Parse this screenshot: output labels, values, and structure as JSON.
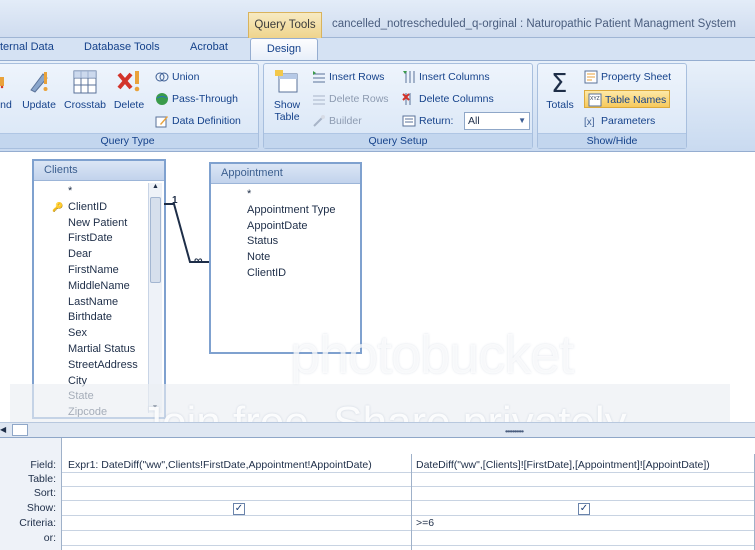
{
  "titlebar": {
    "context_tab": "Query Tools",
    "title": "cancelled_notrescheduled_q-orginal : Naturopathic Patient Managment System"
  },
  "tabs": {
    "external_data": "ternal Data",
    "database_tools": "Database Tools",
    "acrobat": "Acrobat",
    "design": "Design"
  },
  "ribbon": {
    "query_type": {
      "label": "Query Type",
      "buttons": [
        "nd",
        "Update",
        "Crosstab",
        "Delete"
      ],
      "small": [
        "Union",
        "Pass-Through",
        "Data Definition"
      ]
    },
    "query_setup": {
      "label": "Query Setup",
      "show_table": [
        "Show",
        "Table"
      ],
      "col1": [
        "Insert Rows",
        "Delete Rows",
        "Builder"
      ],
      "col2": [
        "Insert Columns",
        "Delete Columns",
        "Return:"
      ],
      "return_value": "All"
    },
    "show_hide": {
      "label": "Show/Hide",
      "totals": "Totals",
      "items": [
        "Property Sheet",
        "Table Names",
        "Parameters"
      ]
    }
  },
  "tables": {
    "clients": {
      "title": "Clients",
      "fields": [
        "*",
        "ClientID",
        "New Patient",
        "FirstDate",
        "Dear",
        "FirstName",
        "MiddleName",
        "LastName",
        "Birthdate",
        "Sex",
        "Martial Status",
        "StreetAddress",
        "City",
        "State",
        "Zipcode"
      ]
    },
    "appointment": {
      "title": "Appointment",
      "fields": [
        "*",
        "Appointment Type",
        "AppointDate",
        "Status",
        "Note",
        "ClientID"
      ]
    },
    "relationship": {
      "one": "1",
      "many": "∞"
    }
  },
  "grid": {
    "row_labels": [
      "Field:",
      "Table:",
      "Sort:",
      "Show:",
      "Criteria:",
      "or:"
    ],
    "col1": {
      "field": "Expr1: DateDiff(\"ww\",Clients!FirstDate,Appointment!AppointDate)",
      "show": "✓",
      "criteria": ""
    },
    "col2": {
      "field": "DateDiff(\"ww\",[Clients]![FirstDate],[Appointment]![AppointDate])",
      "show": "✓",
      "criteria": ">=6"
    }
  },
  "watermark": {
    "line1": "photobucket",
    "line2": "Join free. Share privately."
  }
}
